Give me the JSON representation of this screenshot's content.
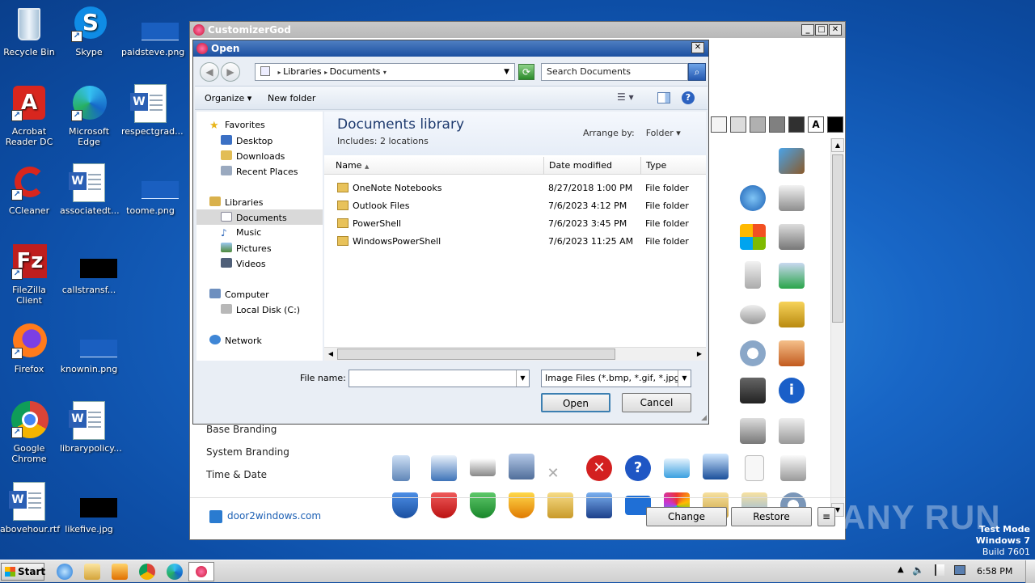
{
  "desktop": {
    "icons": [
      {
        "label": "Recycle Bin"
      },
      {
        "label": "Skype"
      },
      {
        "label": "paidsteve.png"
      },
      {
        "label": "Acrobat Reader DC"
      },
      {
        "label": "Microsoft Edge"
      },
      {
        "label": "respectgrad..."
      },
      {
        "label": "CCleaner"
      },
      {
        "label": "associatedt..."
      },
      {
        "label": "toome.png"
      },
      {
        "label": "FileZilla Client"
      },
      {
        "label": "callstransf..."
      },
      {
        "label": "Firefox"
      },
      {
        "label": "knownin.png"
      },
      {
        "label": "Google Chrome"
      },
      {
        "label": "librarypolicy..."
      },
      {
        "label": "abovehour.rtf"
      },
      {
        "label": "likefive.jpg"
      }
    ]
  },
  "customizer": {
    "title": "CustomizerGod",
    "categories": [
      "Base Branding",
      "System Branding",
      "Time & Date"
    ],
    "footer_link": "door2windows.com",
    "change_label": "Change",
    "restore_label": "Restore",
    "menu_label": "≡",
    "swatch_colors": [
      "#f4f4f4",
      "#dcdcdc",
      "#b0b0b0",
      "#808080",
      "#303030",
      "#ffffff",
      "#000000"
    ]
  },
  "dialog": {
    "title": "Open",
    "breadcrumb": [
      "Libraries",
      "Documents"
    ],
    "search_placeholder": "Search Documents",
    "organize_label": "Organize",
    "new_folder_label": "New folder",
    "nav": {
      "favorites": "Favorites",
      "desktop": "Desktop",
      "downloads": "Downloads",
      "recent": "Recent Places",
      "libraries": "Libraries",
      "documents": "Documents",
      "music": "Music",
      "pictures": "Pictures",
      "videos": "Videos",
      "computer": "Computer",
      "local_disk": "Local Disk (C:)",
      "network": "Network"
    },
    "library_title": "Documents library",
    "includes": "Includes:",
    "locations_link": "2 locations",
    "arrange_label": "Arrange by:",
    "arrange_value": "Folder",
    "columns": [
      "Name",
      "Date modified",
      "Type"
    ],
    "files": [
      {
        "name": "OneNote Notebooks",
        "date": "8/27/2018 1:00 PM",
        "type": "File folder"
      },
      {
        "name": "Outlook Files",
        "date": "7/6/2023 4:12 PM",
        "type": "File folder"
      },
      {
        "name": "PowerShell",
        "date": "7/6/2023 3:45 PM",
        "type": "File folder"
      },
      {
        "name": "WindowsPowerShell",
        "date": "7/6/2023 11:25 AM",
        "type": "File folder"
      }
    ],
    "file_name_label": "File name:",
    "file_name_value": "",
    "file_type_value": "Image Files (*.bmp, *.gif, *.jpg,",
    "open_label": "Open",
    "cancel_label": "Cancel"
  },
  "taskbar": {
    "start_label": "Start",
    "clock": "6:58 PM"
  },
  "watermark": {
    "brand": "ANY RUN",
    "line1": "Test Mode",
    "line2": "Windows 7",
    "line3": "Build 7601"
  }
}
